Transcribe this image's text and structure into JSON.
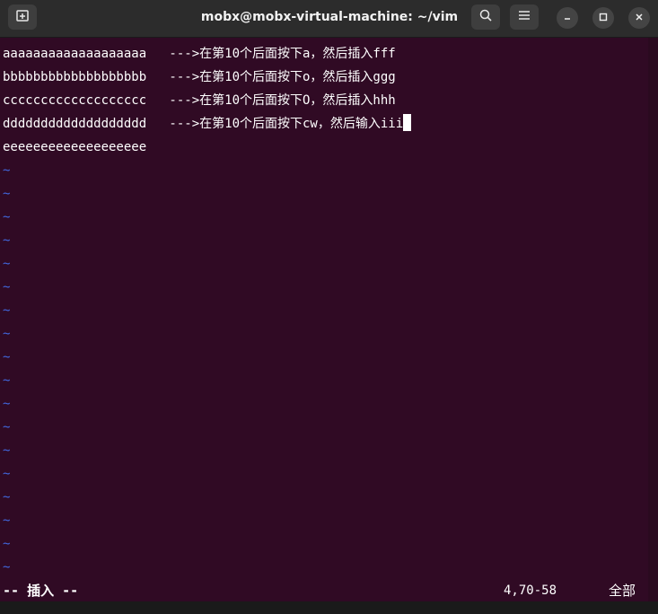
{
  "window": {
    "title": "mobx@mobx-virtual-machine: ~/vim"
  },
  "icons": {
    "new_tab": "new-tab-icon",
    "search": "search-icon",
    "menu": "hamburger-menu-icon",
    "minimize": "minimize-icon",
    "maximize": "maximize-icon",
    "close": "close-icon"
  },
  "buffer": {
    "lines": [
      "aaaaaaaaaaaaaaaaaaa   --->在第10个后面按下a，然后插入fff",
      "bbbbbbbbbbbbbbbbbbb   --->在第10个后面按下o，然后插入ggg",
      "ccccccccccccccccccc   --->在第10个后面按下O，然后插入hhh",
      "ddddddddddddddddddd   --->在第10个后面按下cw，然后输入iii",
      "eeeeeeeeeeeeeeeeeee"
    ],
    "tilde": "~"
  },
  "statusline": {
    "mode": "-- 插入 --",
    "position": "4,70-58",
    "scroll": "全部"
  },
  "colors": {
    "background": "#300a24",
    "titlebar": "#2c2c2c",
    "text": "#ffffff",
    "tilde": "#4169e1"
  }
}
